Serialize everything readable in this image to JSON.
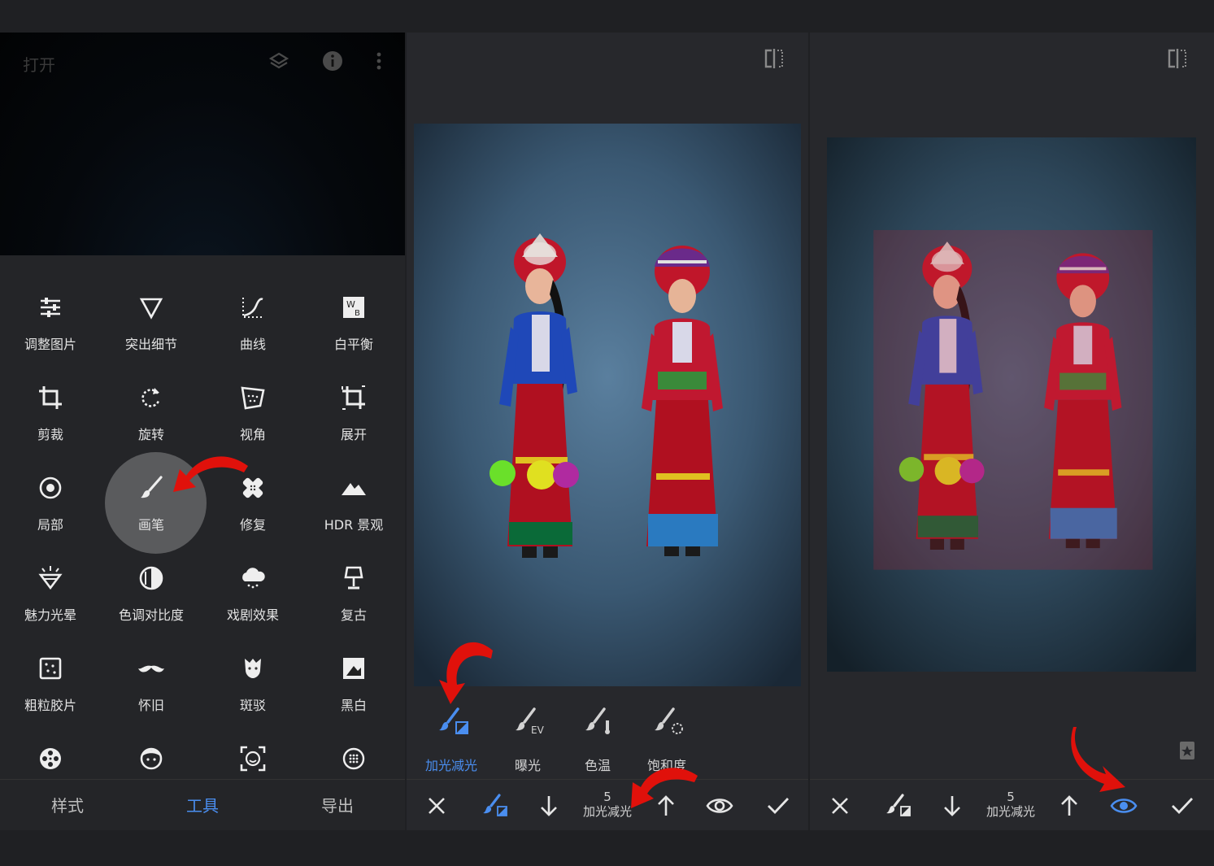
{
  "panel1": {
    "title": "打开",
    "tools": [
      {
        "label": "调整图片",
        "icon": "sliders-icon"
      },
      {
        "label": "突出细节",
        "icon": "triangle-down-icon"
      },
      {
        "label": "曲线",
        "icon": "curves-icon"
      },
      {
        "label": "白平衡",
        "icon": "white-balance-icon"
      },
      {
        "label": "剪裁",
        "icon": "crop-icon"
      },
      {
        "label": "旋转",
        "icon": "rotate-icon"
      },
      {
        "label": "视角",
        "icon": "perspective-icon"
      },
      {
        "label": "展开",
        "icon": "expand-icon"
      },
      {
        "label": "局部",
        "icon": "selective-icon"
      },
      {
        "label": "画笔",
        "icon": "brush-icon"
      },
      {
        "label": "修复",
        "icon": "healing-bandage-icon"
      },
      {
        "label": "HDR 景观",
        "icon": "mountain-icon"
      },
      {
        "label": "魅力光晕",
        "icon": "glamour-glow-icon"
      },
      {
        "label": "色调对比度",
        "icon": "tonal-contrast-icon"
      },
      {
        "label": "戏剧效果",
        "icon": "cloud-icon"
      },
      {
        "label": "复古",
        "icon": "lamp-icon"
      },
      {
        "label": "粗粒胶片",
        "icon": "grainy-film-icon"
      },
      {
        "label": "怀旧",
        "icon": "mustache-icon"
      },
      {
        "label": "斑驳",
        "icon": "grunge-icon"
      },
      {
        "label": "黑白",
        "icon": "black-white-icon"
      },
      {
        "label": "",
        "icon": "film-reel-icon"
      },
      {
        "label": "",
        "icon": "face-icon"
      },
      {
        "label": "",
        "icon": "face-scan-icon"
      },
      {
        "label": "",
        "icon": "dots-circle-icon"
      }
    ],
    "tabs": [
      "样式",
      "工具",
      "导出"
    ],
    "active_tab": "工具"
  },
  "panel2": {
    "brush_tools": [
      {
        "label": "加光减光",
        "icon": "dodge-burn-brush-icon"
      },
      {
        "label": "曝光",
        "icon": "exposure-brush-icon",
        "badge": "EV"
      },
      {
        "label": "色温",
        "icon": "temperature-brush-icon"
      },
      {
        "label": "饱和度",
        "icon": "saturation-brush-icon"
      }
    ],
    "active_brush": "加光减光",
    "brush_value": "5",
    "brush_name": "加光减光"
  },
  "panel3": {
    "brush_value": "5",
    "brush_name": "加光减光"
  },
  "colors": {
    "accent": "#4a8ef0",
    "annotation_arrow": "#e0110b",
    "background": "#1f2023",
    "panel": "#27282c"
  }
}
